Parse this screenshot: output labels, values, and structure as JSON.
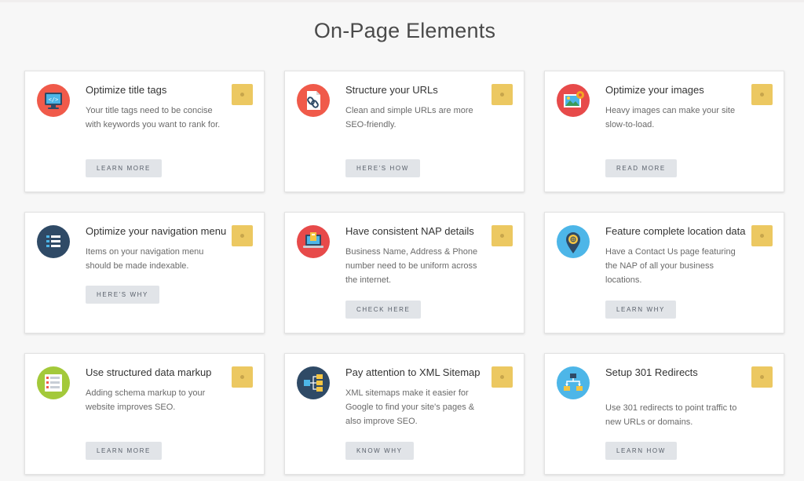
{
  "page": {
    "title": "On-Page Elements"
  },
  "colors": {
    "accent_bookmark": "#ecc861",
    "button_bg": "#e1e4e8",
    "card_bg": "#ffffff",
    "page_bg": "#f7f7f7"
  },
  "cards": [
    {
      "title": "Optimize title tags",
      "description": "Your title tags need to be concise with keywords you want to rank for.",
      "button": "LEARN MORE",
      "icon": "monitor-code-icon"
    },
    {
      "title": "Structure your URLs",
      "description": "Clean and simple URLs are more SEO-friendly.",
      "button": "HERE'S HOW",
      "icon": "link-document-icon"
    },
    {
      "title": "Optimize your images",
      "description": "Heavy images can make your site slow-to-load.",
      "button": "READ MORE",
      "icon": "image-settings-icon"
    },
    {
      "title": "Optimize your navigation menu",
      "description": "Items on your navigation menu should be made indexable.",
      "button": "HERE'S WHY",
      "icon": "menu-list-icon"
    },
    {
      "title": "Have consistent NAP details",
      "description": "Business Name, Address & Phone number need to be uniform across the internet.",
      "button": "CHECK HERE",
      "icon": "laptop-business-icon"
    },
    {
      "title": "Feature complete location data",
      "description": "Have a Contact Us page featuring the NAP of all your business locations.",
      "button": "LEARN WHY",
      "icon": "location-pin-icon"
    },
    {
      "title": "Use structured data markup",
      "description": "Adding schema markup to your website improves SEO.",
      "button": "LEARN MORE",
      "icon": "schema-list-icon"
    },
    {
      "title": "Pay attention to XML Sitemap",
      "description": "XML sitemaps make it easier for Google to find your site's pages & also improve SEO.",
      "button": "KNOW WHY",
      "icon": "sitemap-icon"
    },
    {
      "title": "Setup 301 Redirects",
      "description": "Use 301 redirects to point traffic to new URLs or domains.",
      "button": "LEARN HOW",
      "icon": "redirect-icon"
    }
  ]
}
